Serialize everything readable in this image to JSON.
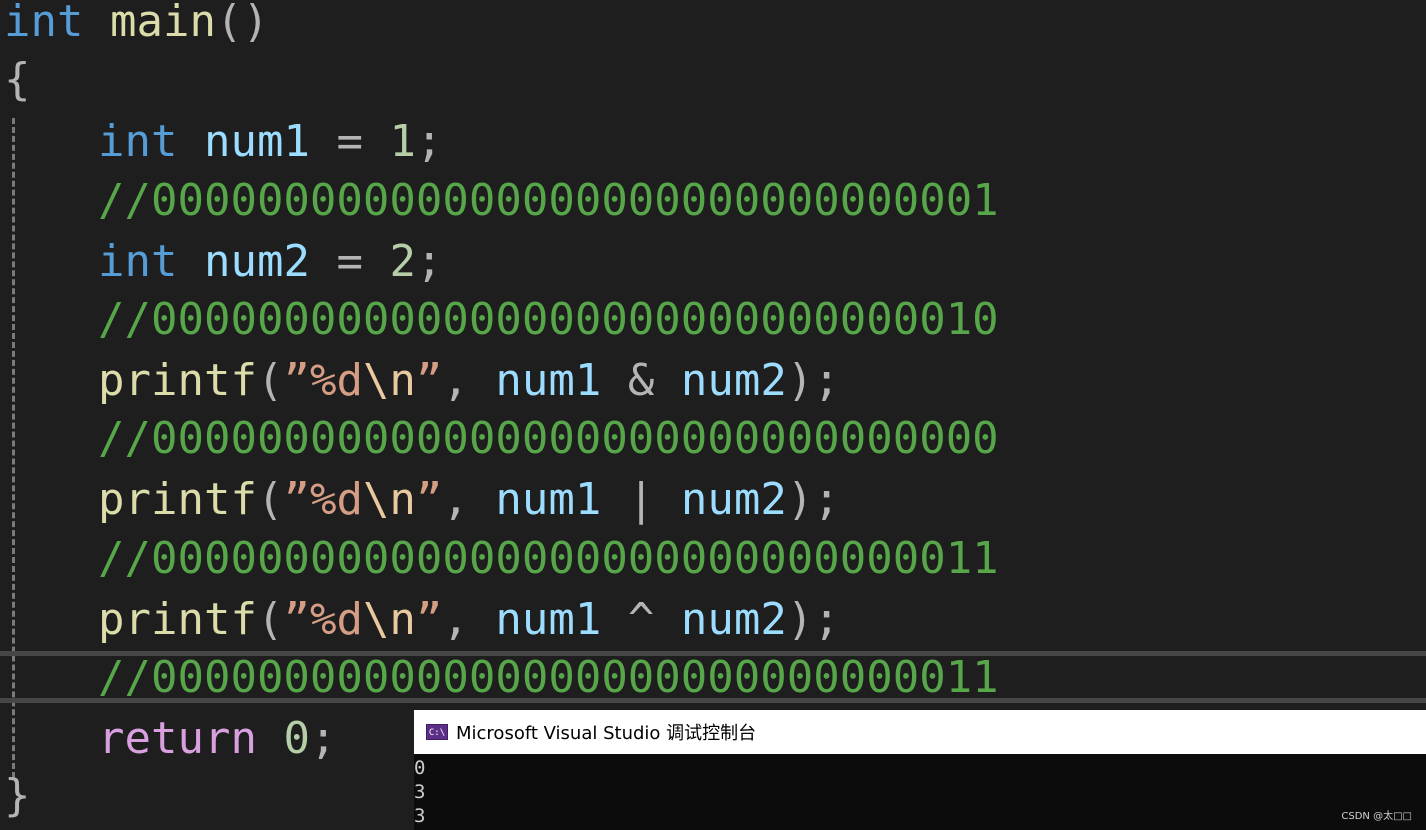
{
  "code": {
    "line1": {
      "kw": "int",
      "fn": "main",
      "paren": "()"
    },
    "line2": {
      "brace": "{"
    },
    "line3": {
      "kw": "int",
      "var": "num1",
      "eq": " = ",
      "num": "1",
      "semi": ";"
    },
    "line4": {
      "comment": "//00000000000000000000000000000001"
    },
    "line5": {
      "kw": "int",
      "var": "num2",
      "eq": " = ",
      "num": "2",
      "semi": ";"
    },
    "line6": {
      "comment": "//00000000000000000000000000000010"
    },
    "line7": {
      "fn": "printf",
      "open": "(",
      "q1": "”",
      "fmt": "%d",
      "esc": "\\n",
      "q2": "”",
      "comma": ", ",
      "a": "num1",
      "op": " & ",
      "b": "num2",
      "close": ");"
    },
    "line8": {
      "comment": "//00000000000000000000000000000000"
    },
    "line9": {
      "fn": "printf",
      "open": "(",
      "q1": "”",
      "fmt": "%d",
      "esc": "\\n",
      "q2": "”",
      "comma": ", ",
      "a": "num1",
      "op": " | ",
      "b": "num2",
      "close": ");"
    },
    "line10": {
      "comment": "//00000000000000000000000000000011"
    },
    "line11": {
      "fn": "printf",
      "open": "(",
      "q1": "”",
      "fmt": "%d",
      "esc": "\\n",
      "q2": "”",
      "comma": ", ",
      "a": "num1",
      "op": " ^ ",
      "b": "num2",
      "close": ");"
    },
    "line12": {
      "comment": "//00000000000000000000000000000011"
    },
    "line13": {
      "ctl": "return",
      "num": "0",
      "semi": ";"
    },
    "line14": {
      "brace": "}"
    }
  },
  "console": {
    "icon_text": "C:\\",
    "title": "Microsoft Visual Studio 调试控制台",
    "output": [
      "0",
      "3",
      "3"
    ]
  },
  "watermark": "CSDN @太□□",
  "colors": {
    "background": "#1e1e1e",
    "keyword": "#569cd6",
    "variable": "#9cdcfe",
    "function": "#dcdcaa",
    "string": "#d69d85",
    "comment": "#57a64a",
    "control": "#d8a0df",
    "console_bg": "#0c0c0c"
  }
}
